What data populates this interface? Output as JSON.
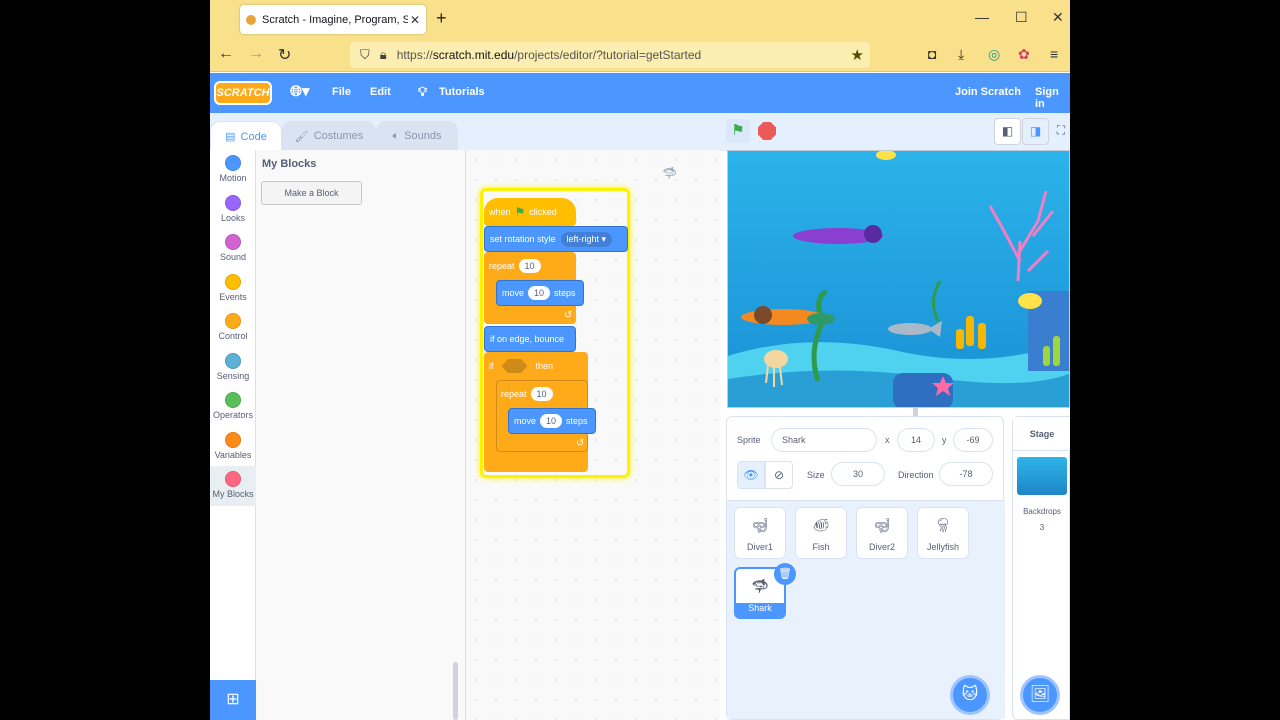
{
  "browser": {
    "tab_title": "Scratch - Imagine, Program, Share",
    "url_host": "scratch.mit.edu",
    "url_prefix": "https://",
    "url_path": "/projects/editor/?tutorial=getStarted"
  },
  "menu": {
    "logo": "SCRATCH",
    "file": "File",
    "edit": "Edit",
    "tutorials": "Tutorials",
    "join": "Join Scratch",
    "signin": "Sign in"
  },
  "tabs": {
    "code": "Code",
    "costumes": "Costumes",
    "sounds": "Sounds"
  },
  "categories": [
    {
      "label": "Motion",
      "color": "#4c97ff"
    },
    {
      "label": "Looks",
      "color": "#9966ff"
    },
    {
      "label": "Sound",
      "color": "#cf63cf"
    },
    {
      "label": "Events",
      "color": "#ffbf00"
    },
    {
      "label": "Control",
      "color": "#ffab19"
    },
    {
      "label": "Sensing",
      "color": "#5cb1d6"
    },
    {
      "label": "Operators",
      "color": "#59c059"
    },
    {
      "label": "Variables",
      "color": "#ff8c1a"
    },
    {
      "label": "My Blocks",
      "color": "#ff6680"
    }
  ],
  "flyout": {
    "heading": "My Blocks",
    "make_block": "Make a Block"
  },
  "script": {
    "when": "when",
    "clicked": "clicked",
    "set_rotation": "set rotation style",
    "rotation_value": "left-right",
    "repeat": "repeat",
    "repeat_count": "10",
    "move": "move",
    "move_steps": "10",
    "steps": "steps",
    "bounce": "if on edge, bounce",
    "if": "if",
    "then": "then",
    "repeat2_count": "10",
    "move2_steps": "10"
  },
  "sprite_info": {
    "sprite_label": "Sprite",
    "sprite_name": "Shark",
    "x_label": "x",
    "x_value": "14",
    "y_label": "y",
    "y_value": "-69",
    "size_label": "Size",
    "size_value": "30",
    "direction_label": "Direction",
    "direction_value": "-78"
  },
  "sprites": [
    {
      "name": "Diver1",
      "icon": "diver-icon"
    },
    {
      "name": "Fish",
      "icon": "fish-icon"
    },
    {
      "name": "Diver2",
      "icon": "diver-icon"
    },
    {
      "name": "Jellyfish",
      "icon": "jellyfish-icon"
    },
    {
      "name": "Shark",
      "icon": "shark-icon",
      "selected": true
    }
  ],
  "stage_panel": {
    "title": "Stage",
    "backdrops_label": "Backdrops",
    "backdrops_count": "3"
  }
}
